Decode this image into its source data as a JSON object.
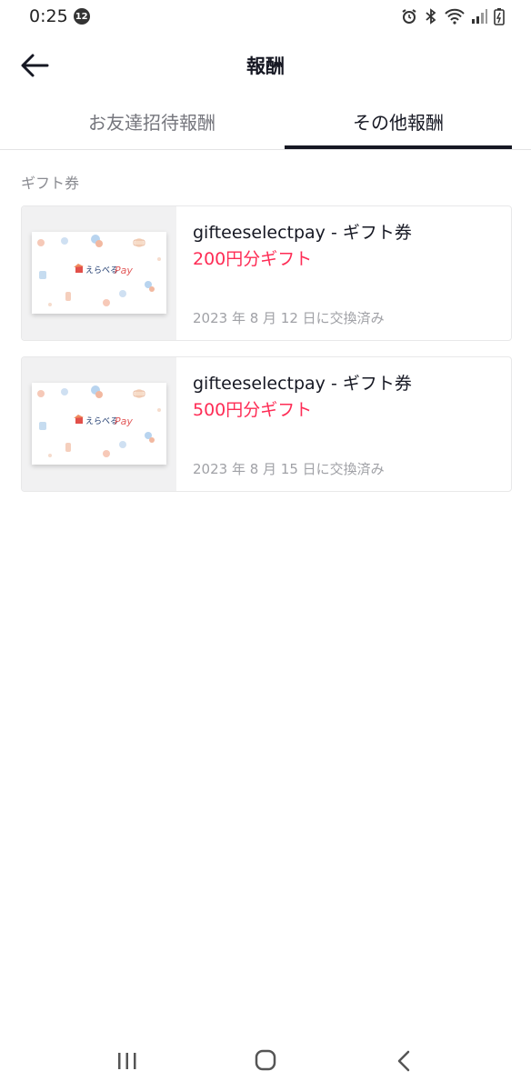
{
  "status_bar": {
    "time": "0:25",
    "notification_count": "12"
  },
  "header": {
    "title": "報酬"
  },
  "tabs": [
    {
      "label": "お友達招待報酬",
      "active": false
    },
    {
      "label": "その他報酬",
      "active": true
    }
  ],
  "section": {
    "label": "ギフト券"
  },
  "rewards": [
    {
      "title": "gifteeselectpay - ギフト券",
      "amount": "200円分ギフト",
      "date": "2023 年 8 月 12 日に交換済み",
      "voucher_brand": "えらべる",
      "voucher_pay": "Pay"
    },
    {
      "title": "gifteeselectpay - ギフト券",
      "amount": "500円分ギフト",
      "date": "2023 年 8 月 15 日に交換済み",
      "voucher_brand": "えらべる",
      "voucher_pay": "Pay"
    }
  ],
  "colors": {
    "accent": "#fe2c55",
    "text_primary": "#161823",
    "text_secondary": "#75767d",
    "date_text": "#a0a1a6"
  },
  "icons": {
    "status": [
      "alarm-icon",
      "bluetooth-icon",
      "wifi-icon",
      "signal-icon",
      "battery-icon"
    ],
    "header": "back-arrow-icon",
    "navbar": [
      "recent-apps-icon",
      "home-icon",
      "nav-back-icon"
    ]
  }
}
